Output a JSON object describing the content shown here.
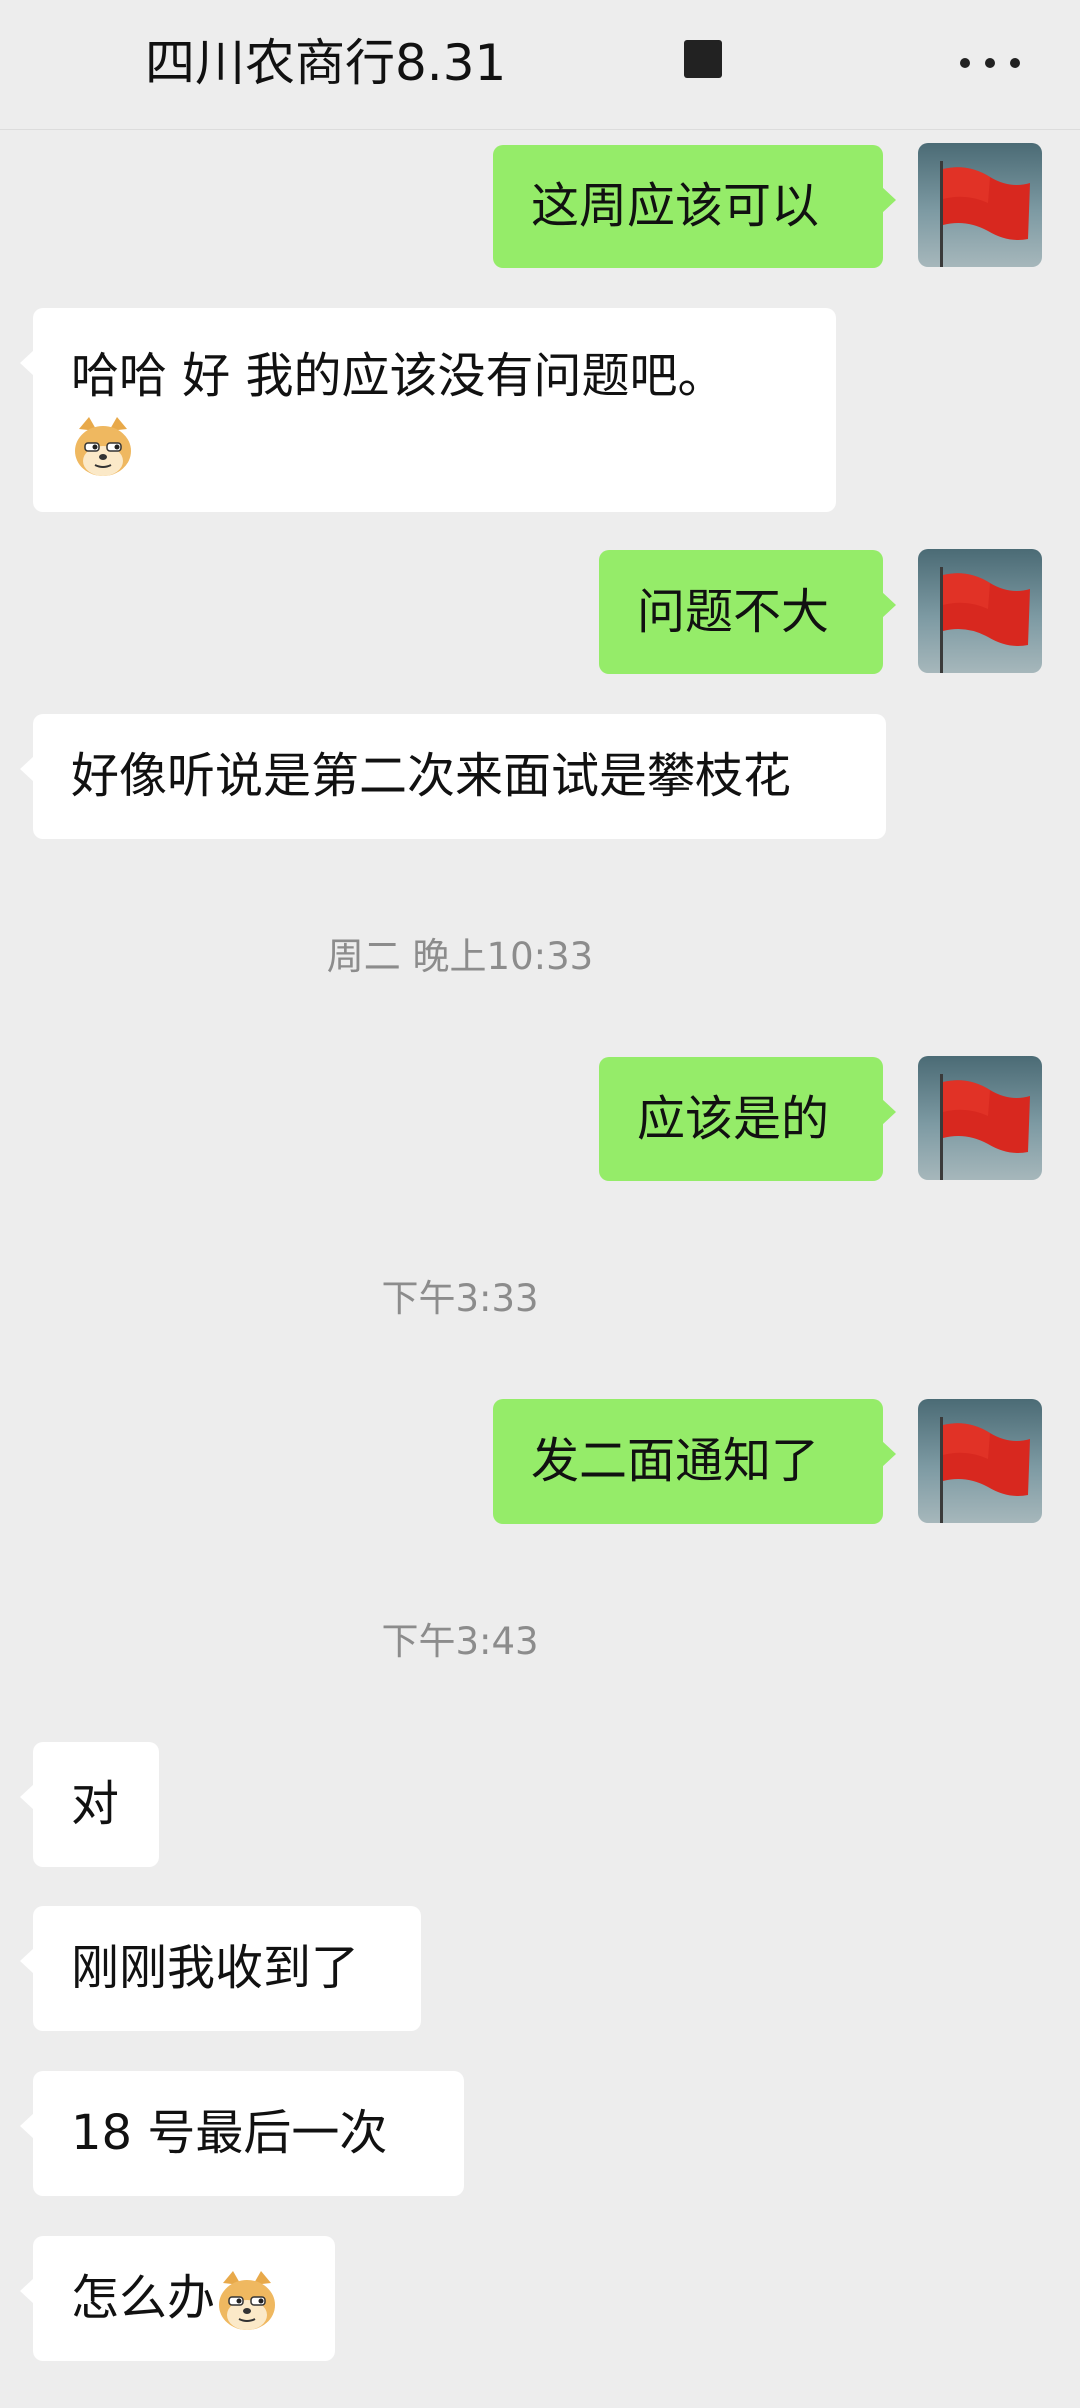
{
  "header": {
    "title": "四川农商行8.31",
    "more_icon": "more-horizontal-icon",
    "indicator_icon": "square-icon"
  },
  "colors": {
    "background": "#ededed",
    "outgoing_bubble": "#95ec69",
    "incoming_bubble": "#ffffff",
    "timestamp": "#8c8c8c"
  },
  "messages": [
    {
      "dir": "out",
      "text": "这周应该可以"
    },
    {
      "dir": "in",
      "text": "哈哈  好   我的应该没有问题吧。",
      "emoji": "doge-emoji"
    },
    {
      "dir": "out",
      "text": "问题不大"
    },
    {
      "dir": "in",
      "text": "好像听说是第二次来面试是攀枝花"
    },
    {
      "dir": "out",
      "text": "应该是的"
    },
    {
      "dir": "out",
      "text": "发二面通知了"
    },
    {
      "dir": "in",
      "text": "对"
    },
    {
      "dir": "in",
      "text": "刚刚我收到了"
    },
    {
      "dir": "in",
      "text": "18 号最后一次"
    },
    {
      "dir": "in",
      "text": "怎么办",
      "emoji": "doge-emoji"
    }
  ],
  "timestamps": [
    "周二 晚上10:33",
    "下午3:33",
    "下午3:43"
  ],
  "avatar": {
    "icon": "red-flag-avatar-icon"
  }
}
